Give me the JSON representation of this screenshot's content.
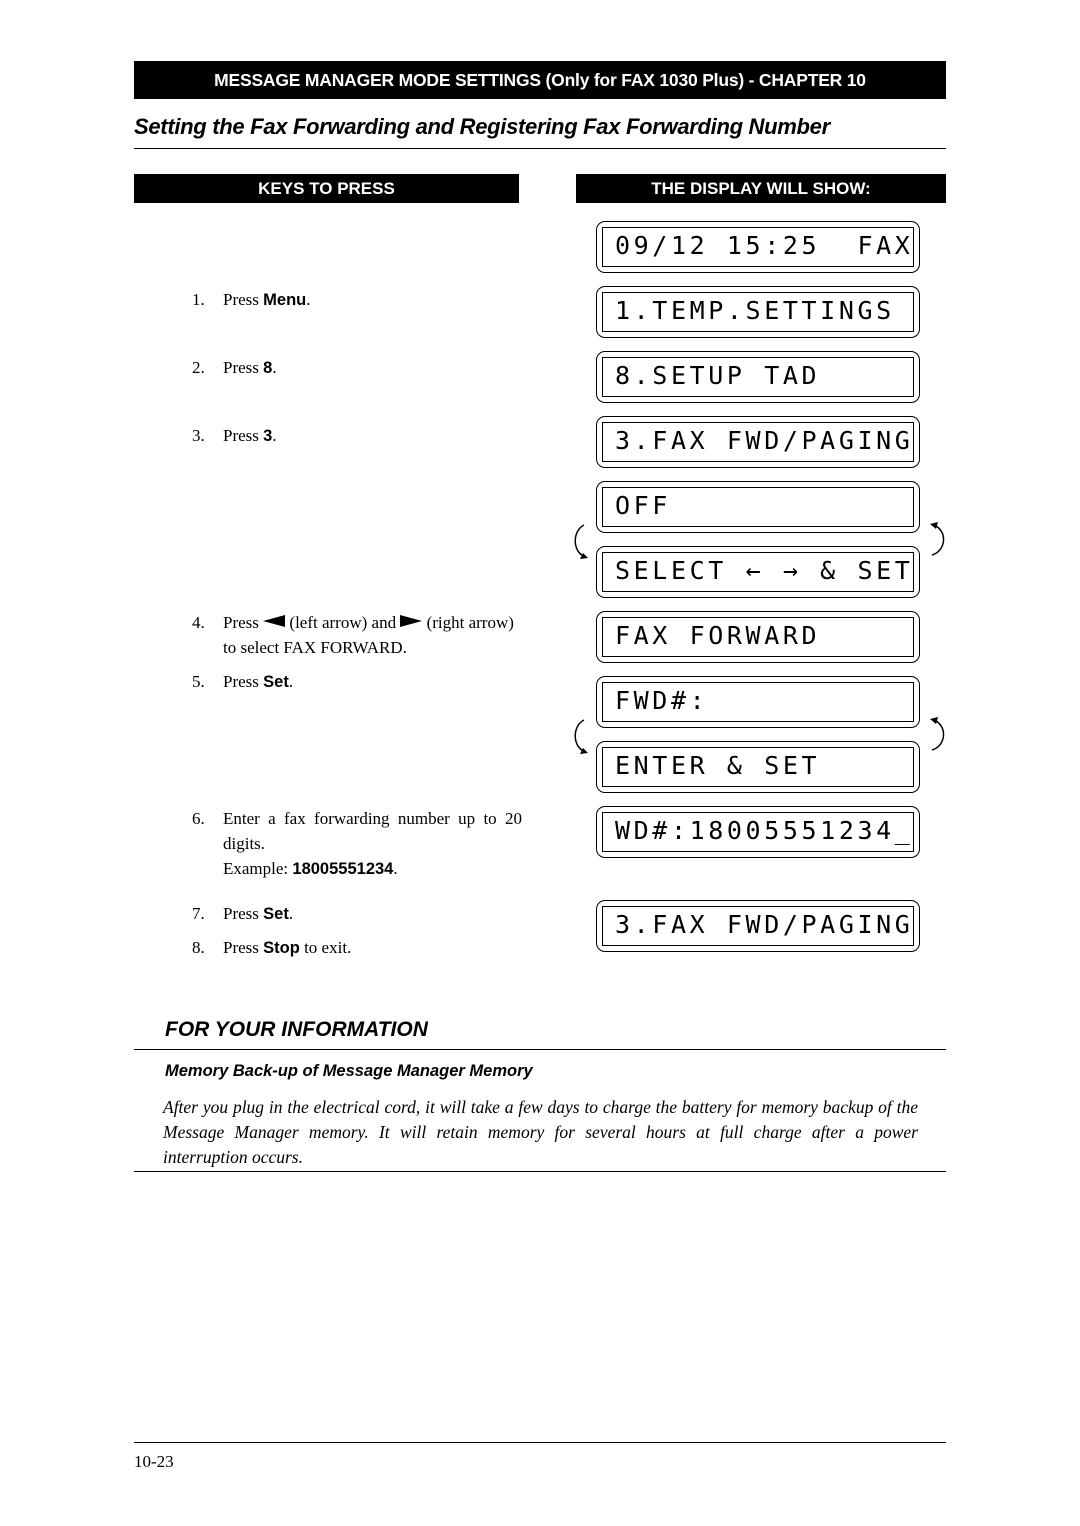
{
  "header": {
    "chapter_bar": "MESSAGE MANAGER MODE SETTINGS (Only for FAX 1030 Plus) - CHAPTER 10",
    "title": "Setting the Fax Forwarding and Registering Fax Forwarding Number"
  },
  "columns": {
    "keys_to_press": "KEYS TO PRESS",
    "display_will_show": "THE DISPLAY WILL SHOW:"
  },
  "steps": [
    {
      "num": "1.",
      "pre": "Press ",
      "key": "Menu",
      "post": "."
    },
    {
      "num": "2.",
      "pre": "Press ",
      "key": "8",
      "post": "."
    },
    {
      "num": "3.",
      "pre": "Press ",
      "key": "3",
      "post": "."
    },
    {
      "num": "4.",
      "pre": "Press ",
      "left_label": "(left arrow) and ",
      "right_label": "(right arrow) to select FAX FORWARD."
    },
    {
      "num": "5.",
      "pre": "Press ",
      "key": "Set",
      "post": "."
    },
    {
      "num": "6.",
      "text": "Enter a fax forwarding number up to 20 digits.",
      "example_label": "Example: ",
      "example_value": "18005551234",
      "post": "."
    },
    {
      "num": "7.",
      "pre": "Press ",
      "key": "Set",
      "post": "."
    },
    {
      "num": "8.",
      "pre": "Press ",
      "key": "Stop",
      "post": " to exit."
    }
  ],
  "displays": [
    "09/12 15:25  FAX",
    "1.TEMP.SETTINGS",
    "8.SETUP TAD",
    "3.FAX FWD/PAGING",
    "OFF",
    "SELECT ← → & SET",
    "FAX FORWARD",
    "FWD#:",
    "ENTER & SET",
    "WD#:18005551234_",
    "3.FAX FWD/PAGING"
  ],
  "info": {
    "title": "FOR YOUR INFORMATION",
    "subtitle": "Memory Back-up of Message Manager Memory",
    "body": "After you plug in the electrical cord, it will take a few days to charge the battery for memory backup of the Message Manager memory. It will retain memory for several hours at full charge after a power interruption occurs."
  },
  "footer": {
    "page_number": "10-23"
  }
}
